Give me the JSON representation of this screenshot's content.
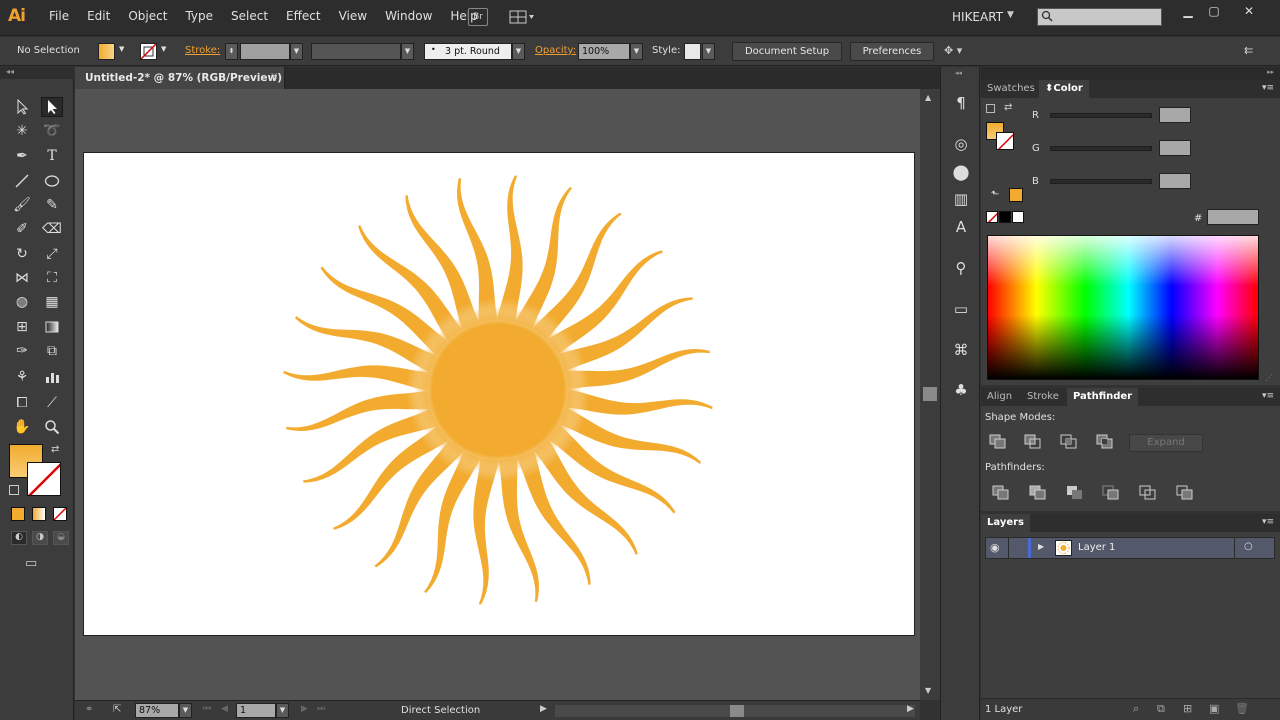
{
  "app": {
    "logo": "Ai"
  },
  "menu": [
    "File",
    "Edit",
    "Object",
    "Type",
    "Select",
    "Effect",
    "View",
    "Window",
    "Help"
  ],
  "menubar": {
    "bridge_label": "Br",
    "workspace": "HIKEART"
  },
  "control": {
    "selection_label": "No Selection",
    "stroke_label": "Stroke:",
    "brush_label": "3 pt. Round",
    "opacity_label": "Opacity:",
    "opacity_value": "100%",
    "style_label": "Style:",
    "doc_setup": "Document Setup",
    "preferences": "Preferences"
  },
  "document": {
    "tab_title": "Untitled-2* @ 87% (RGB/Preview)",
    "close": "×"
  },
  "status": {
    "zoom": "87%",
    "page": "1",
    "tool": "Direct Selection"
  },
  "color_panel": {
    "tabs": [
      "Swatches",
      "Color"
    ],
    "channels": [
      "R",
      "G",
      "B"
    ],
    "hex_label": "#"
  },
  "pathfinder_panel": {
    "tabs": [
      "Align",
      "Stroke",
      "Pathfinder"
    ],
    "shape_modes_label": "Shape Modes:",
    "expand_label": "Expand",
    "pathfinders_label": "Pathfinders:"
  },
  "layers_panel": {
    "tab": "Layers",
    "layer_name": "Layer 1",
    "footer_count": "1 Layer"
  },
  "colors": {
    "fill": "#f2ab2f",
    "accent": "#f0a030"
  }
}
